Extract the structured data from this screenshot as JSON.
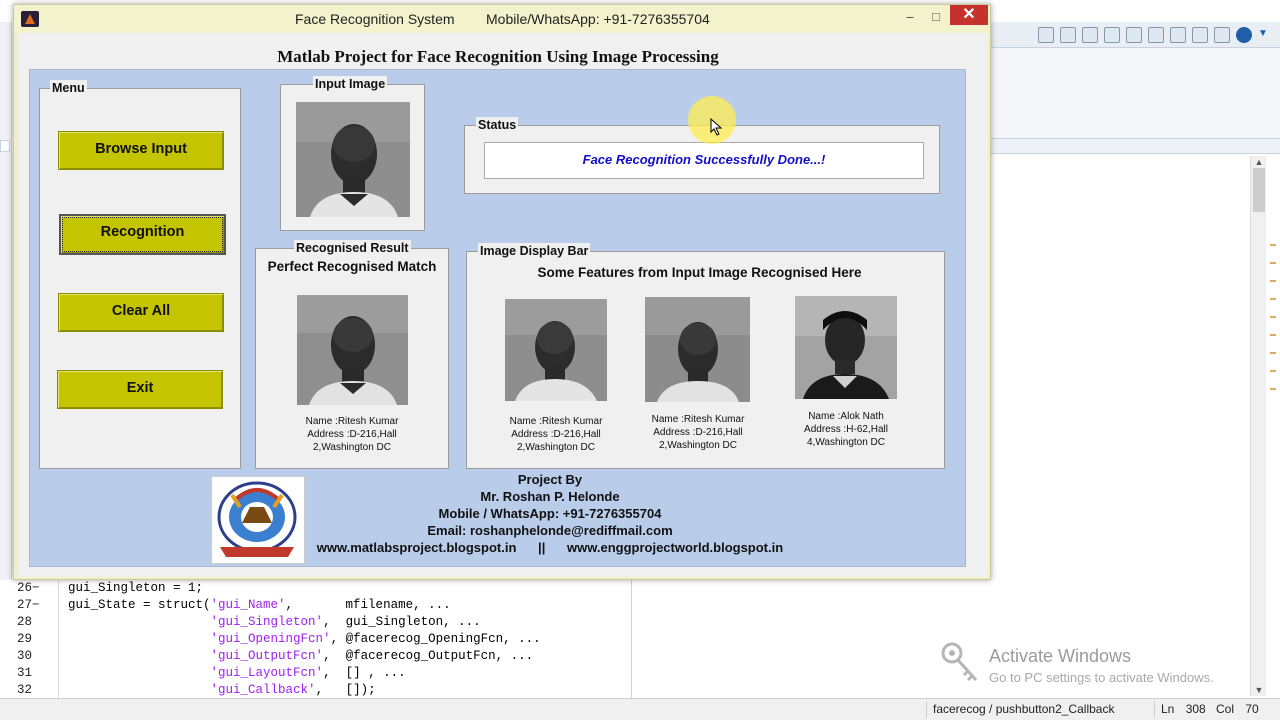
{
  "window": {
    "title": "Face Recognition System",
    "contact": "Mobile/WhatsApp: +91-7276355704",
    "minimize": "−",
    "maximize": "□",
    "close": "✕"
  },
  "heading": "Matlab Project for Face Recognition Using Image Processing",
  "menu": {
    "legend": "Menu",
    "buttons": [
      "Browse Input",
      "Recognition",
      "Clear All",
      "Exit"
    ]
  },
  "input_panel": {
    "legend": "Input Image"
  },
  "status_panel": {
    "legend": "Status",
    "message": "Face Recognition Successfully Done...!"
  },
  "result_panel": {
    "legend": "Recognised Result",
    "headline": "Perfect Recognised Match",
    "name": "Name :Ritesh Kumar",
    "address1": "Address :D-216,Hall",
    "address2": "2,Washington DC"
  },
  "display_bar": {
    "legend": "Image Display Bar",
    "caption": "Some Features from Input Image Recognised Here",
    "items": [
      {
        "name": "Name :Ritesh Kumar",
        "address1": "Address :D-216,Hall",
        "address2": "2,Washington DC"
      },
      {
        "name": "Name :Ritesh Kumar",
        "address1": "Address :D-216,Hall",
        "address2": "2,Washington DC"
      },
      {
        "name": "Name :Alok Nath",
        "address1": "Address :H-62,Hall",
        "address2": "4,Washington DC"
      }
    ]
  },
  "footer": {
    "line1": "Project By",
    "line2": "Mr. Roshan P. Helonde",
    "line3": "Mobile / WhatsApp: +91-7276355704",
    "line4": "Email: roshanphelonde@rediffmail.com",
    "line5": "www.matlabsproject.blogspot.in      ||      www.enggprojectworld.blogspot.in"
  },
  "code": {
    "lines": [
      {
        "num": "26",
        "dash": "−",
        "text": "gui_Singleton = 1;"
      },
      {
        "num": "27",
        "dash": "−",
        "pre": "gui_State = struct(",
        "str": "'gui_Name'",
        "post": ",       mfilename, ..."
      },
      {
        "num": "28",
        "dash": "",
        "pre": "                   ",
        "str": "'gui_Singleton'",
        "post": ",  gui_Singleton, ..."
      },
      {
        "num": "29",
        "dash": "",
        "pre": "                   ",
        "str": "'gui_OpeningFcn'",
        "post": ", @facerecog_OpeningFcn, ..."
      },
      {
        "num": "30",
        "dash": "",
        "pre": "                   ",
        "str": "'gui_OutputFcn'",
        "post": ",  @facerecog_OutputFcn, ..."
      },
      {
        "num": "31",
        "dash": "",
        "pre": "                   ",
        "str": "'gui_LayoutFcn'",
        "post": ",  [] , ..."
      },
      {
        "num": "32",
        "dash": "",
        "pre": "                   ",
        "str": "'gui_Callback'",
        "post": ",   []);"
      }
    ]
  },
  "statusbar": {
    "function": "facerecog / pushbutton2_Callback",
    "ln_label": "Ln",
    "ln": "308",
    "col_label": "Col",
    "col": "70"
  },
  "watermark": {
    "title": "Activate Windows",
    "subtitle": "Go to PC settings to activate Windows."
  },
  "colors": {
    "button": "#c4c400",
    "panel": "#b9cdea",
    "status_text": "#1010c8",
    "window_frame": "#f0f0c8",
    "close_button": "#c7312d"
  },
  "icons": [
    "matlab-icon",
    "key-icon",
    "cursor-icon"
  ]
}
